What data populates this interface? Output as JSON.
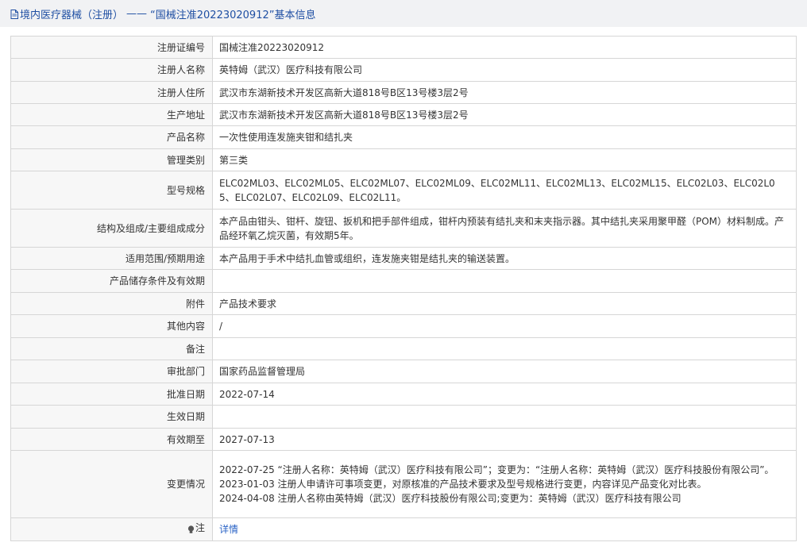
{
  "header": {
    "category": "境内医疗器械（注册）",
    "separator": "——",
    "record_title": "“国械注准20223020912”基本信息"
  },
  "rows": [
    {
      "label": "注册证编号",
      "value": "国械注准20223020912"
    },
    {
      "label": "注册人名称",
      "value": "英特姆（武汉）医疗科技有限公司"
    },
    {
      "label": "注册人住所",
      "value": "武汉市东湖新技术开发区高新大道818号B区13号楼3层2号"
    },
    {
      "label": "生产地址",
      "value": "武汉市东湖新技术开发区高新大道818号B区13号楼3层2号"
    },
    {
      "label": "产品名称",
      "value": "一次性使用连发施夹钳和结扎夹"
    },
    {
      "label": "管理类别",
      "value": "第三类"
    },
    {
      "label": "型号规格",
      "value": "ELC02ML03、ELC02ML05、ELC02ML07、ELC02ML09、ELC02ML11、ELC02ML13、ELC02ML15、ELC02L03、ELC02L05、ELC02L07、ELC02L09、ELC02L11。"
    },
    {
      "label": "结构及组成/主要组成成分",
      "value": "本产品由钳头、钳杆、旋钮、扳机和把手部件组成，钳杆内预装有结扎夹和末夹指示器。其中结扎夹采用聚甲醛（POM）材料制成。产品经环氧乙烷灭菌，有效期5年。"
    },
    {
      "label": "适用范围/预期用途",
      "value": "本产品用于手术中结扎血管或组织，连发施夹钳是结扎夹的输送装置。"
    },
    {
      "label": "产品储存条件及有效期",
      "value": ""
    },
    {
      "label": "附件",
      "value": "产品技术要求"
    },
    {
      "label": "其他内容",
      "value": "/"
    },
    {
      "label": "备注",
      "value": ""
    },
    {
      "label": "审批部门",
      "value": "国家药品监督管理局"
    },
    {
      "label": "批准日期",
      "value": "2022-07-14"
    },
    {
      "label": "生效日期",
      "value": ""
    },
    {
      "label": "有效期至",
      "value": "2027-07-13"
    }
  ],
  "changes": {
    "label": "变更情况",
    "lines": [
      "2022-07-25 “注册人名称：英特姆（武汉）医疗科技有限公司”；变更为：“注册人名称：英特姆（武汉）医疗科技股份有限公司”。",
      "2023-01-03 注册人申请许可事项变更，对原核准的产品技术要求及型号规格进行变更，内容详见产品变化对比表。",
      "2024-04-08 注册人名称由英特姆（武汉）医疗科技股份有限公司;变更为：英特姆（武汉）医疗科技有限公司"
    ]
  },
  "note_row": {
    "icon": "bulb-icon",
    "label": "注",
    "link_text": "详情"
  },
  "colors": {
    "title_text": "#1f4fa3",
    "title_bg": "#f1f2f4",
    "label_bg": "#f7f7f7",
    "border": "#d6d6d6",
    "link": "#2a63c6"
  }
}
